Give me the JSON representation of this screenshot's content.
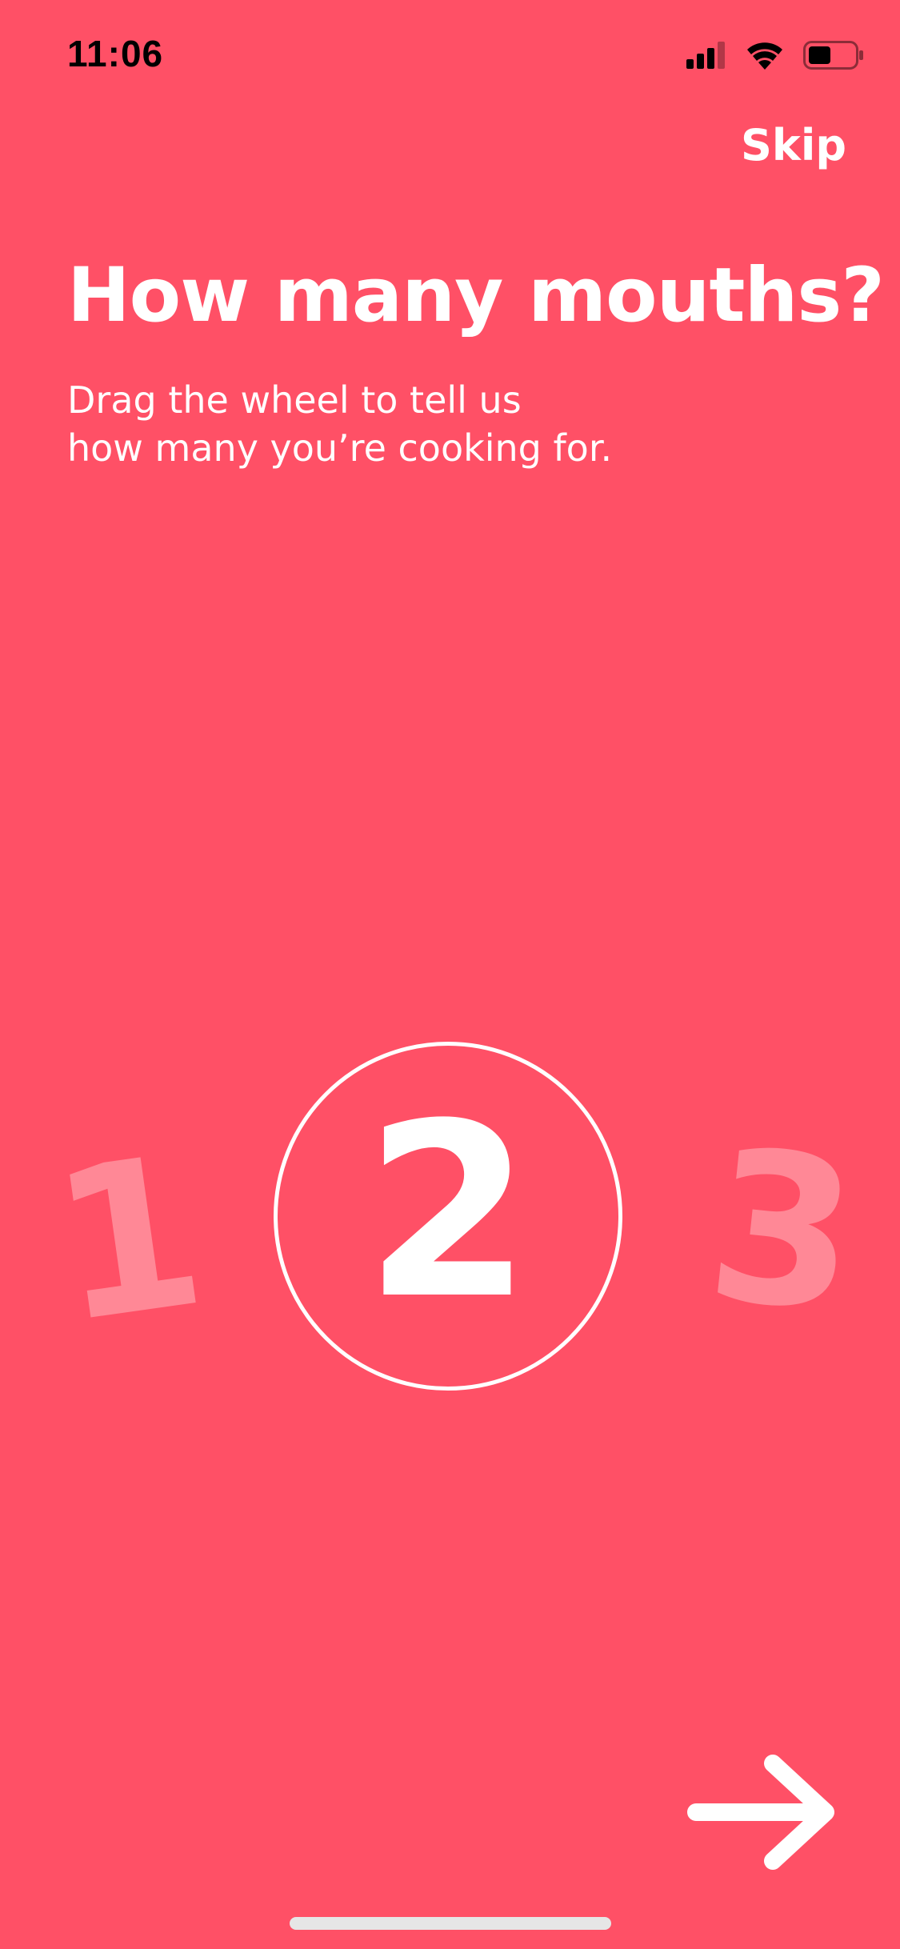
{
  "status_bar": {
    "time": "11:06",
    "icons": [
      "cellular-signal-icon",
      "wifi-icon",
      "battery-icon"
    ]
  },
  "header": {
    "skip_label": "Skip"
  },
  "main": {
    "title": "How many mouths?",
    "subtitle_lines": [
      "Drag the wheel to tell us",
      "how many you’re cooking for."
    ]
  },
  "wheel": {
    "previous_value": "1",
    "selected_value": "2",
    "next_value": "3"
  },
  "footer": {
    "next_icon": "arrow-right-icon"
  },
  "colors": {
    "background": "#FF5066",
    "foreground": "#FFFFFF",
    "inactive_number": "#FF8896"
  }
}
